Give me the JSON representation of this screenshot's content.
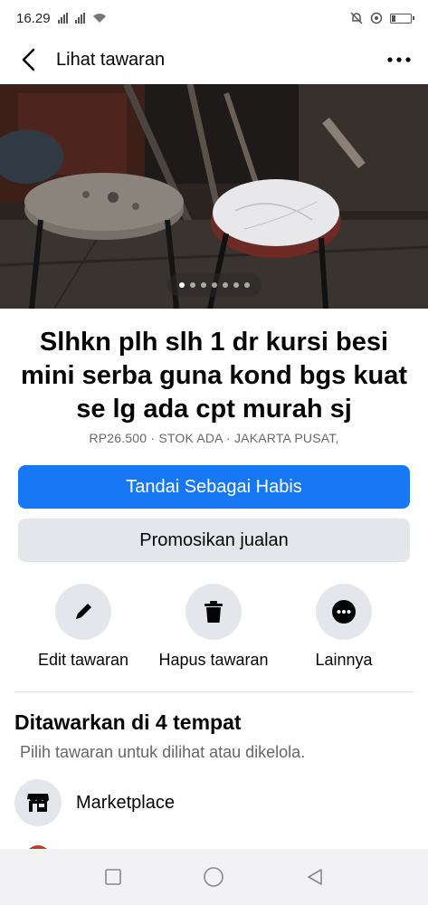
{
  "status": {
    "time": "16.29"
  },
  "appbar": {
    "title": "Lihat tawaran"
  },
  "listing": {
    "title": "Slhkn plh slh 1 dr kursi besi mini serba guna kond bgs kuat se lg ada cpt murah sj",
    "meta": "RP26.500 · STOK ADA · JAKARTA PUSAT,",
    "photo_count": 7,
    "active_photo": 1
  },
  "buttons": {
    "mark_sold": "Tandai Sebagai Habis",
    "promote": "Promosikan jualan"
  },
  "actions": {
    "edit": "Edit tawaran",
    "delete": "Hapus tawaran",
    "more": "Lainnya"
  },
  "section": {
    "title": "Ditawarkan di 4 tempat",
    "subtitle": "Pilih tawaran untuk dilihat atau dikelola.",
    "items": [
      {
        "label": "Marketplace",
        "icon": "storefront-icon"
      }
    ]
  },
  "colors": {
    "primary": "#1877f2",
    "secondary": "#e4e6eb"
  }
}
